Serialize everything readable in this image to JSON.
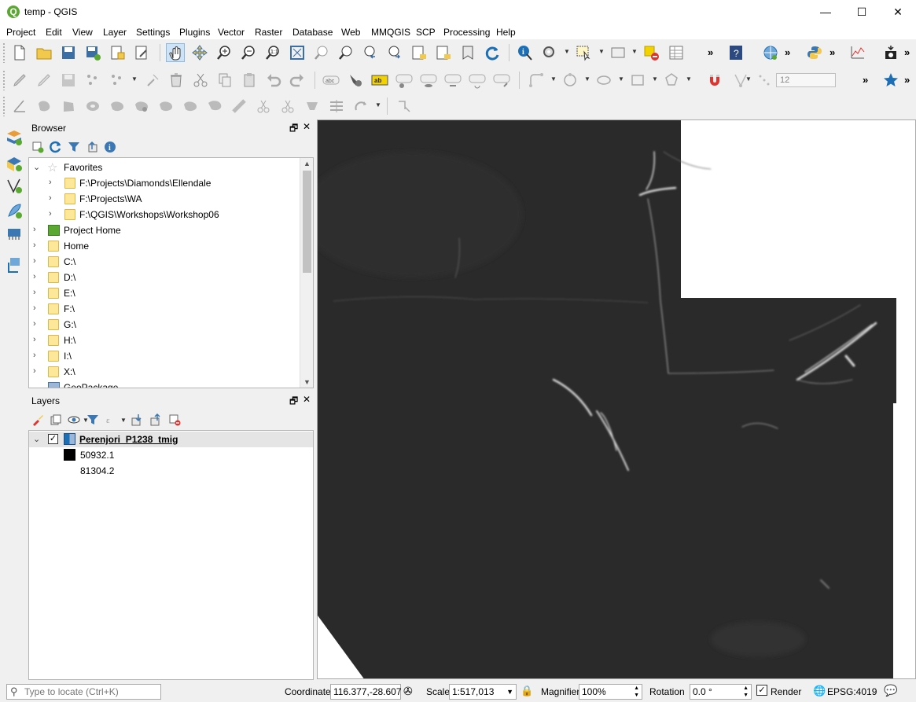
{
  "window": {
    "title": "temp - QGIS",
    "app_icon_letter": "Q",
    "minimize": "—",
    "maximize": "☐",
    "close": "✕"
  },
  "menu": [
    "Project",
    "Edit",
    "View",
    "Layer",
    "Settings",
    "Plugins",
    "Vector",
    "Raster",
    "Database",
    "Web",
    "MMQGIS",
    "SCP",
    "Processing",
    "Help"
  ],
  "toolbar": {
    "overflow_label": "»",
    "snapping_tolerance": "12"
  },
  "browser": {
    "title": "Browser",
    "float_label": "🗗",
    "close_label": "✕",
    "items": [
      {
        "label": "Favorites",
        "expanded": true
      },
      {
        "label": "F:\\Projects\\Diamonds\\Ellendale"
      },
      {
        "label": "F:\\Projects\\WA"
      },
      {
        "label": "F:\\QGIS\\Workshops\\Workshop06"
      },
      {
        "label": "Project Home"
      },
      {
        "label": "Home"
      },
      {
        "label": "C:\\"
      },
      {
        "label": "D:\\"
      },
      {
        "label": "E:\\"
      },
      {
        "label": "F:\\"
      },
      {
        "label": "G:\\"
      },
      {
        "label": "H:\\"
      },
      {
        "label": "I:\\"
      },
      {
        "label": "X:\\"
      },
      {
        "label": "GeoPackage"
      }
    ]
  },
  "layers": {
    "title": "Layers",
    "float_label": "🗗",
    "close_label": "✕",
    "layer_name": "Perenjori_P1238_tmig",
    "checked": true,
    "legend": [
      {
        "label": "50932.1",
        "color": "#000000"
      },
      {
        "label": "81304.2",
        "color": "#ffffff"
      }
    ]
  },
  "statusbar": {
    "locate_placeholder": "Type to locate (Ctrl+K)",
    "coordinate_label": "Coordinate",
    "coordinate_value": "116.377,-28.607",
    "scale_label": "Scale",
    "scale_value": "1:517,013",
    "magnifier_label": "Magnifier",
    "magnifier_value": "100%",
    "rotation_label": "Rotation",
    "rotation_value": "0.0 °",
    "render_label": "Render",
    "render_checked": true,
    "crs_label": "EPSG:4019"
  },
  "colors": {
    "raster_base": "#2a2a2a",
    "accent_blue": "#1c6fb5",
    "qgis_green": "#5aa832"
  }
}
